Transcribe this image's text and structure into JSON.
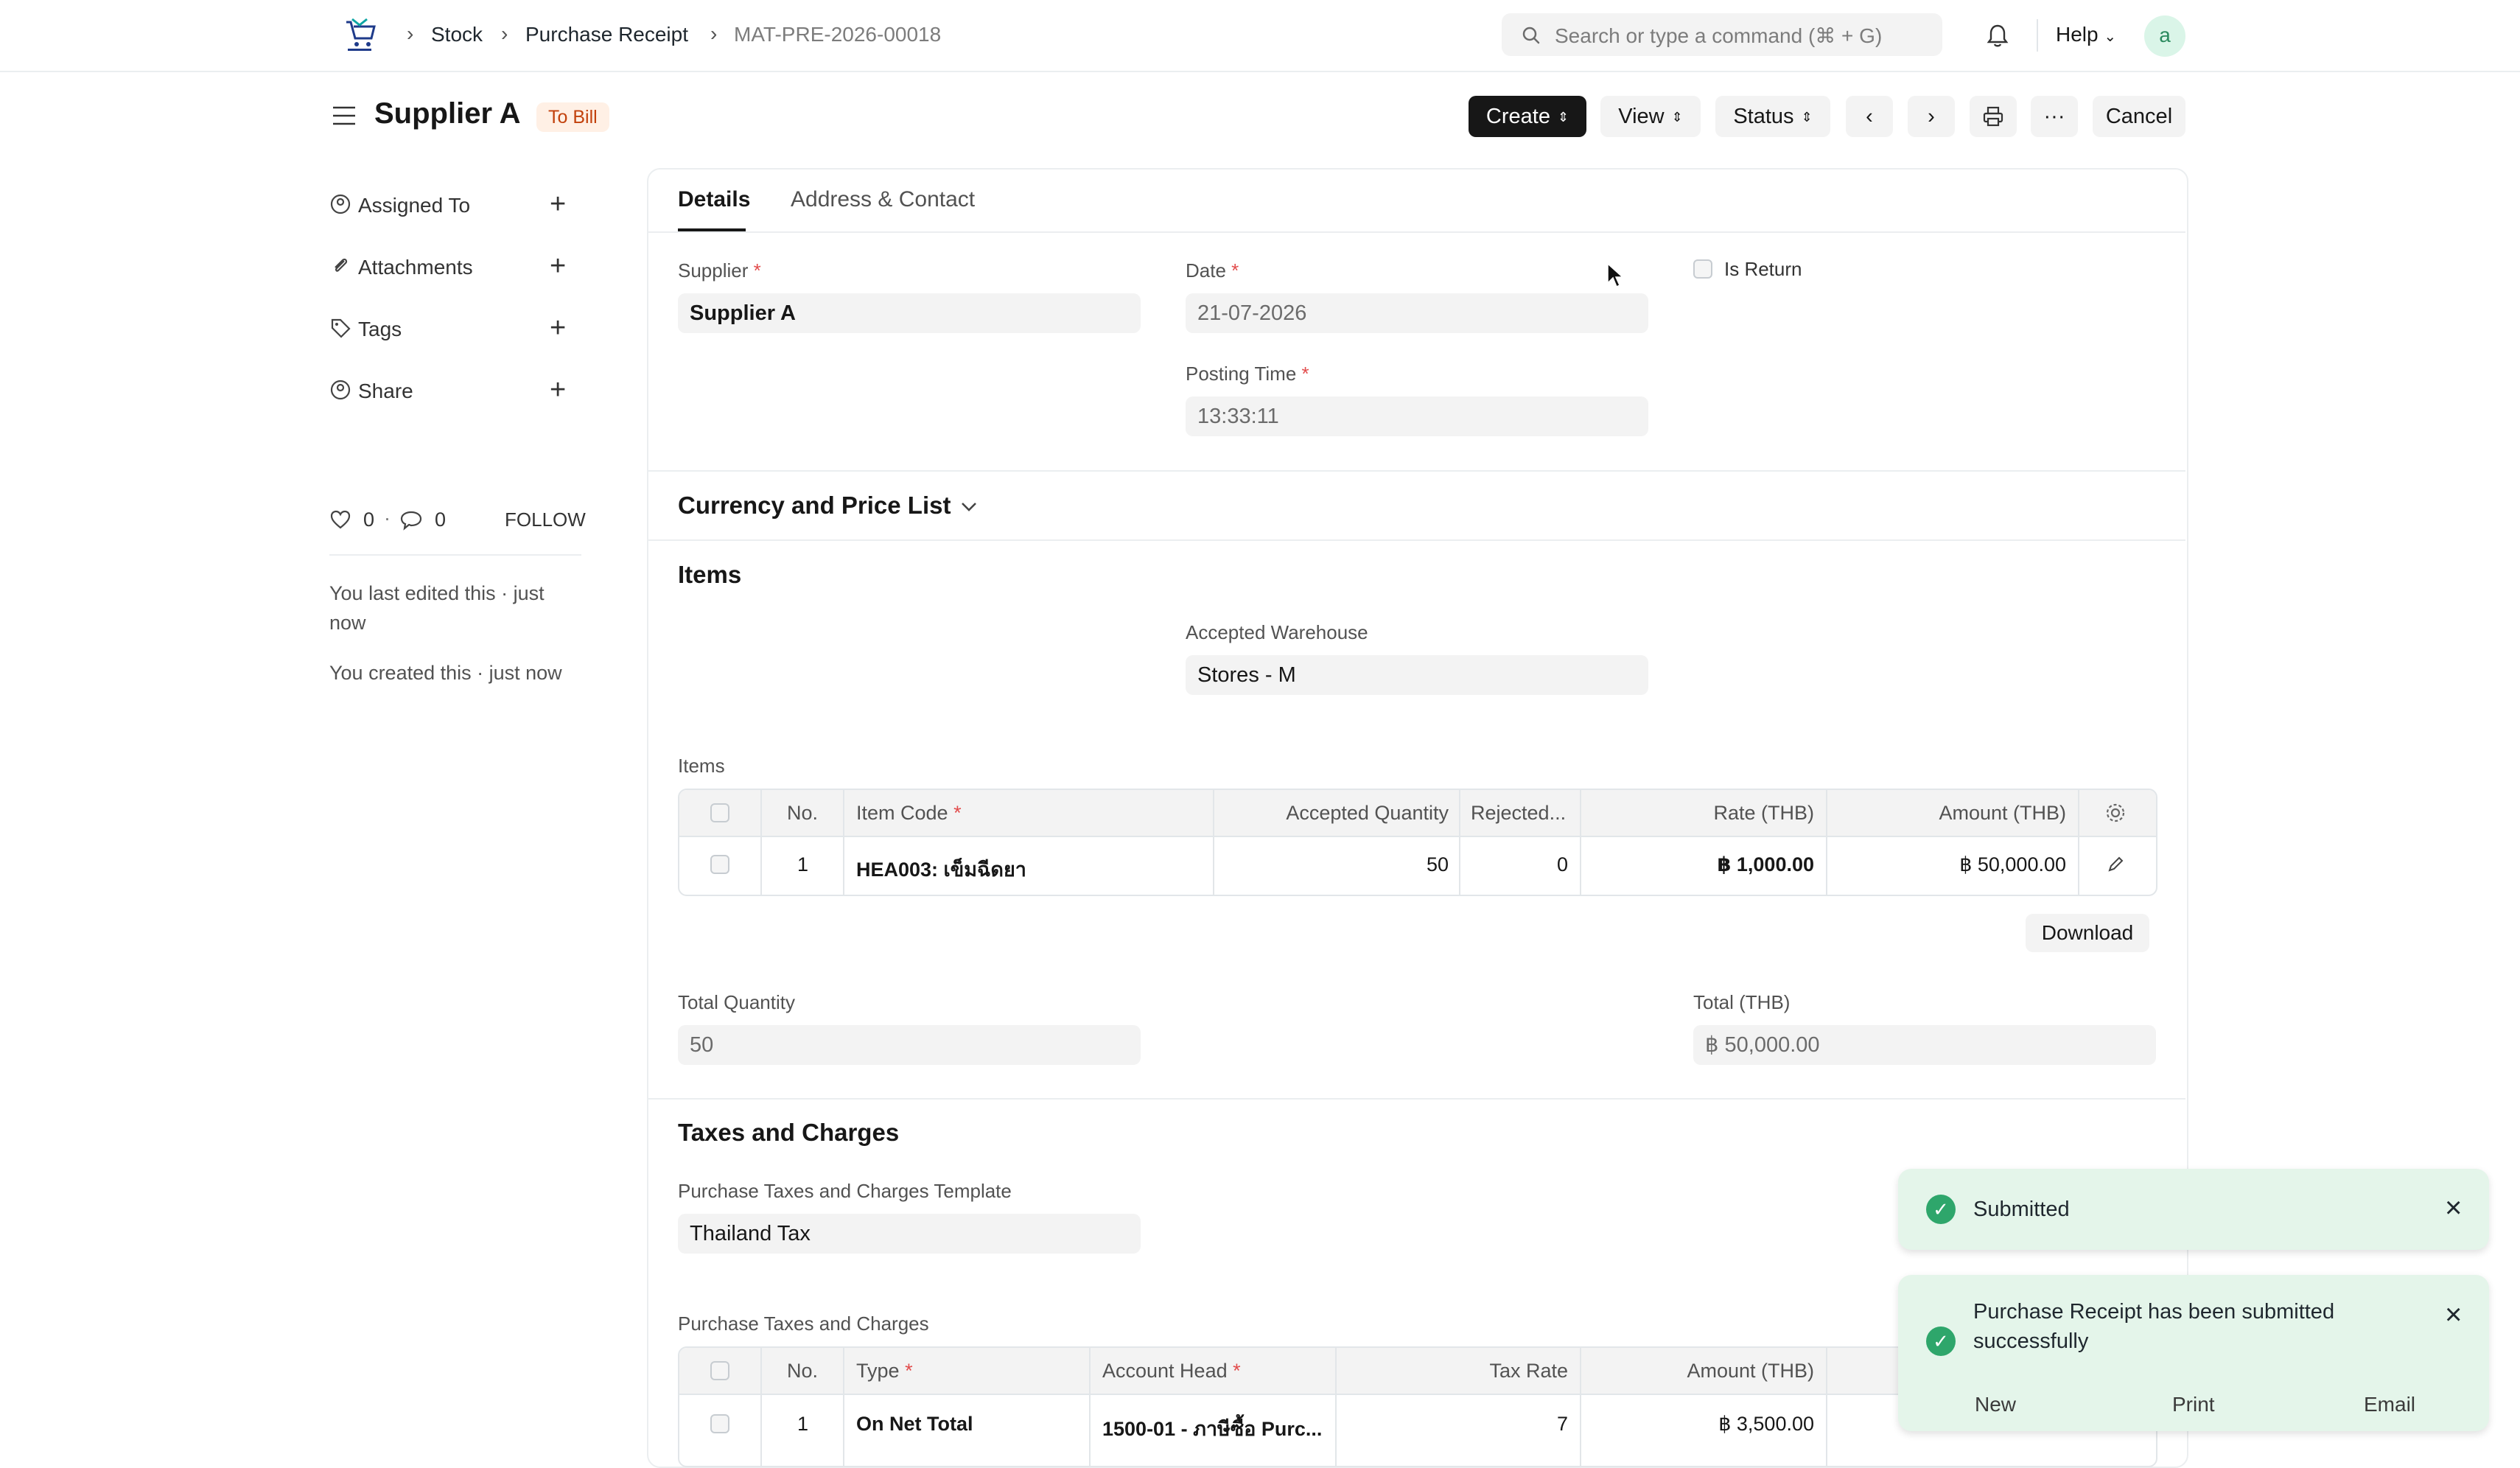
{
  "breadcrumb": {
    "items": [
      "Stock",
      "Purchase Receipt",
      "MAT-PRE-2026-00018"
    ]
  },
  "navbar": {
    "search_placeholder": "Search or type a command (⌘ + G)",
    "help": "Help",
    "avatar_letter": "a"
  },
  "page": {
    "title": "Supplier A",
    "status": "To Bill"
  },
  "actions": {
    "create": "Create",
    "view": "View",
    "status": "Status",
    "more": "···",
    "cancel": "Cancel"
  },
  "sidebar": {
    "items": [
      {
        "label": "Assigned To"
      },
      {
        "label": "Attachments"
      },
      {
        "label": "Tags"
      },
      {
        "label": "Share"
      }
    ],
    "likes": "0",
    "comments": "0",
    "follow": "FOLLOW",
    "last_edited": "You last edited this · just now",
    "created": "You created this · just now"
  },
  "tabs": [
    "Details",
    "Address & Contact"
  ],
  "form": {
    "supplier_label": "Supplier",
    "supplier_value": "Supplier A",
    "date_label": "Date",
    "date_value": "21-07-2026",
    "posting_time_label": "Posting Time",
    "posting_time_value": "13:33:11",
    "is_return_label": "Is Return",
    "currency_section": "Currency and Price List",
    "items_section": "Items",
    "accepted_warehouse_label": "Accepted Warehouse",
    "accepted_warehouse_value": "Stores - M",
    "items_table_label": "Items",
    "total_quantity_label": "Total Quantity",
    "total_quantity_value": "50",
    "total_label": "Total (THB)",
    "total_value": "฿ 50,000.00",
    "taxes_section": "Taxes and Charges",
    "tax_template_label": "Purchase Taxes and Charges Template",
    "tax_template_value": "Thailand Tax",
    "taxes_table_label": "Purchase Taxes and Charges"
  },
  "items_table": {
    "headers": [
      "No.",
      "Item Code",
      "Accepted Quantity",
      "Rejected...",
      "Rate (THB)",
      "Amount (THB)"
    ],
    "rows": [
      {
        "no": "1",
        "item_code": "HEA003: เข็มฉีดยา",
        "accepted_qty": "50",
        "rejected": "0",
        "rate": "฿ 1,000.00",
        "amount": "฿ 50,000.00"
      }
    ],
    "download": "Download"
  },
  "taxes_table": {
    "headers": [
      "No.",
      "Type",
      "Account Head",
      "Tax Rate",
      "Amount (THB)"
    ],
    "rows": [
      {
        "no": "1",
        "type": "On Net Total",
        "account_head": "1500-01 - ภาษีซื้อ Purc...",
        "tax_rate": "7",
        "amount": "฿ 3,500.00"
      }
    ]
  },
  "toasts": {
    "first": "Submitted",
    "second": "Purchase Receipt has been submitted successfully",
    "actions": [
      "New",
      "Print",
      "Email"
    ]
  },
  "colors": {
    "accent": "#171717",
    "status_pill_bg": "#fff0e5",
    "status_pill_text": "#c2410c",
    "toast_bg": "#e4f5ea",
    "success": "#2ea66b"
  }
}
